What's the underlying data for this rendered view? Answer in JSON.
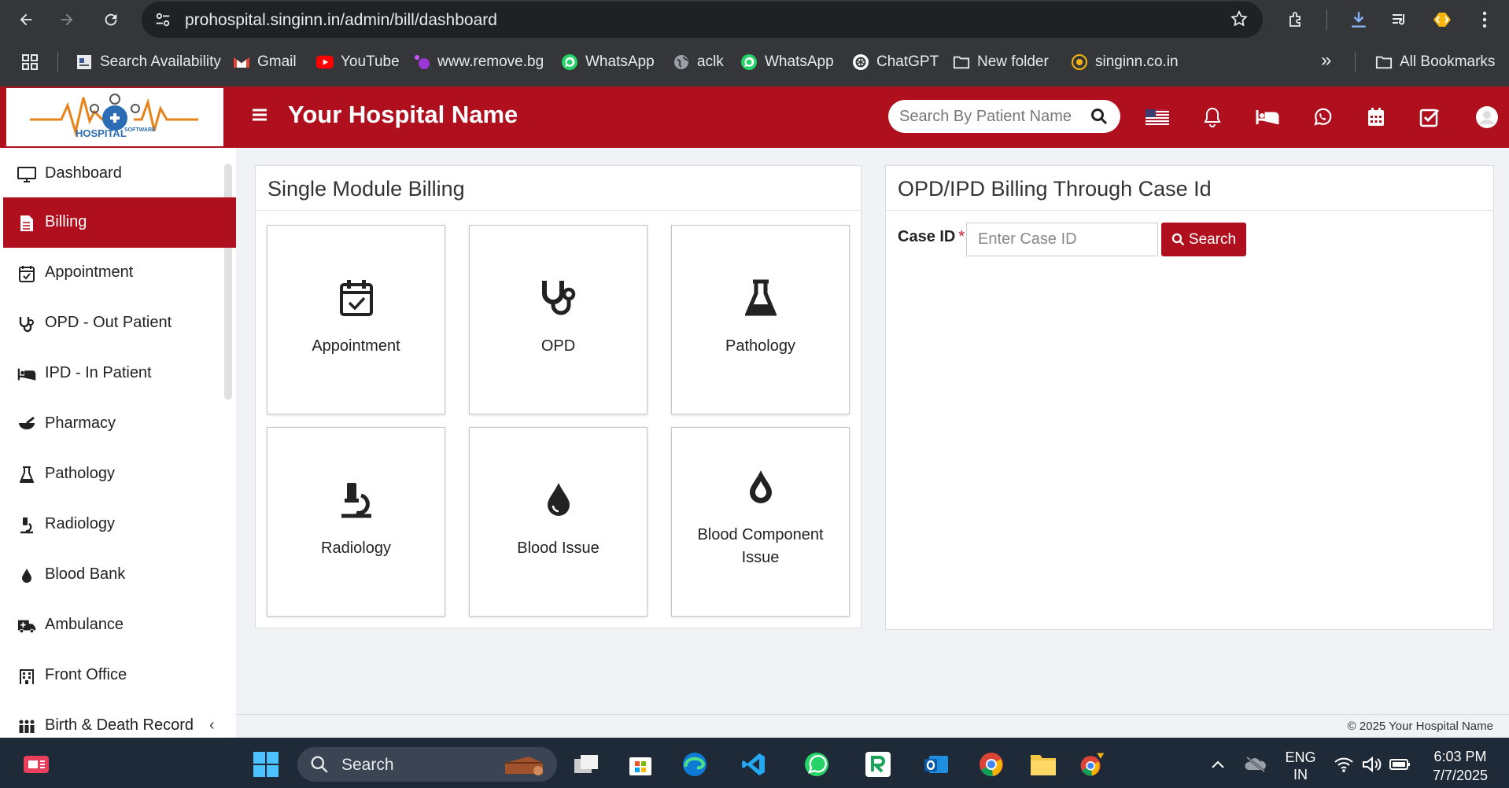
{
  "browser": {
    "url": "prohospital.singinn.in/admin/bill/dashboard",
    "bookmarks": [
      {
        "label": "Search Availability",
        "icon": "page-icon"
      },
      {
        "label": "Gmail",
        "icon": "gmail-icon"
      },
      {
        "label": "YouTube",
        "icon": "youtube-icon"
      },
      {
        "label": "www.remove.bg",
        "icon": "removebg-icon"
      },
      {
        "label": "WhatsApp",
        "icon": "whatsapp-icon"
      },
      {
        "label": "aclk",
        "icon": "globe-icon"
      },
      {
        "label": "WhatsApp",
        "icon": "whatsapp-icon"
      },
      {
        "label": "ChatGPT",
        "icon": "chatgpt-icon"
      },
      {
        "label": "New folder",
        "icon": "folder-icon"
      },
      {
        "label": "singinn.co.in",
        "icon": "singinn-icon"
      }
    ],
    "all_bookmarks": "All Bookmarks",
    "overflow": "»"
  },
  "header": {
    "hospital_name": "Your Hospital Name",
    "logo_text": "HOSPITAL",
    "logo_subtext": "SOFTWARE",
    "search_placeholder": "Search By Patient Name",
    "accent_color": "#b00f1d"
  },
  "sidebar": {
    "items": [
      {
        "label": "Dashboard",
        "icon": "monitor-icon"
      },
      {
        "label": "Billing",
        "icon": "billing-icon",
        "active": true
      },
      {
        "label": "Appointment",
        "icon": "calendar-check-icon"
      },
      {
        "label": "OPD - Out Patient",
        "icon": "stethoscope-icon"
      },
      {
        "label": "IPD - In Patient",
        "icon": "bed-icon"
      },
      {
        "label": "Pharmacy",
        "icon": "mortar-pestle-icon"
      },
      {
        "label": "Pathology",
        "icon": "flask-icon"
      },
      {
        "label": "Radiology",
        "icon": "microscope-icon"
      },
      {
        "label": "Blood Bank",
        "icon": "tint-icon"
      },
      {
        "label": "Ambulance",
        "icon": "ambulance-icon"
      },
      {
        "label": "Front Office",
        "icon": "building-icon"
      },
      {
        "label": "Birth & Death Record",
        "icon": "people-icon"
      }
    ],
    "expand_chevron": "‹"
  },
  "single_module": {
    "title": "Single Module Billing",
    "tiles": [
      {
        "label": "Appointment",
        "icon": "calendar-check-icon"
      },
      {
        "label": "OPD",
        "icon": "stethoscope-icon"
      },
      {
        "label": "Pathology",
        "icon": "flask-icon"
      },
      {
        "label": "Radiology",
        "icon": "microscope-icon"
      },
      {
        "label": "Blood Issue",
        "icon": "tint-icon"
      },
      {
        "label": "Blood Component Issue",
        "icon": "tint-outline-icon"
      }
    ]
  },
  "case_billing": {
    "title": "OPD/IPD Billing Through Case Id",
    "case_label": "Case ID",
    "required_mark": "*",
    "placeholder": "Enter Case ID",
    "search_label": "Search"
  },
  "footer": {
    "copyright": "© 2025 Your Hospital Name"
  },
  "taskbar": {
    "search_label": "Search",
    "lang_top": "ENG",
    "lang_bottom": "IN",
    "time": "6:03 PM",
    "date": "7/7/2025"
  }
}
